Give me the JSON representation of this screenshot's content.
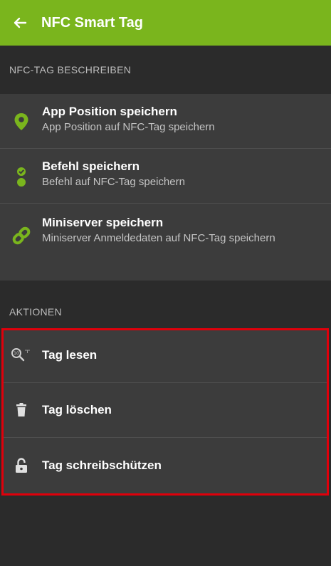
{
  "appbar": {
    "title": "NFC Smart Tag",
    "back_icon": "arrow-left-icon",
    "color": "#7ab51d"
  },
  "write_section": {
    "header": "NFC-TAG BESCHREIBEN",
    "items": [
      {
        "title": "App Position speichern",
        "subtitle": "App Position auf NFC-Tag speichern",
        "icon": "location-pin-icon"
      },
      {
        "title": "Befehl speichern",
        "subtitle": "Befehl auf NFC-Tag speichern",
        "icon": "command-icon"
      },
      {
        "title": "Miniserver speichern",
        "subtitle": "Miniserver Anmeldedaten auf NFC-Tag speichern",
        "icon": "link-icon"
      }
    ]
  },
  "actions_section": {
    "header": "AKTIONEN",
    "items": [
      {
        "label": "Tag lesen",
        "icon": "read-tag-icon"
      },
      {
        "label": "Tag löschen",
        "icon": "trash-icon"
      },
      {
        "label": "Tag schreibschützen",
        "icon": "lock-icon"
      }
    ],
    "highlight_color": "#e0000b"
  }
}
